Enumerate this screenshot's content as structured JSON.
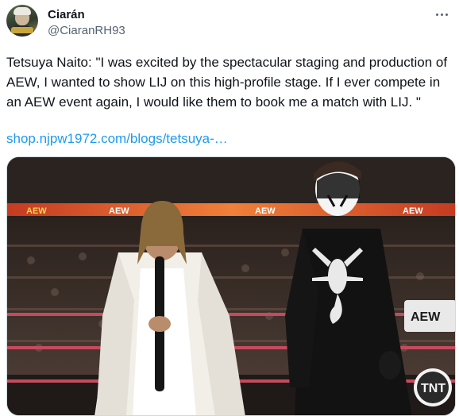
{
  "author": {
    "display_name": "Ciarán",
    "handle": "@CiaranRH93",
    "avatar_icon": "avatar"
  },
  "more_icon": "more-horizontal-icon",
  "tweet": {
    "text": "Tetsuya Naito: \"I was excited by the spectacular staging and production of AEW, I wanted to show LIJ on this high-profile stage. If I ever compete in an AEW event again, I would like them to book me a match with LIJ. \"",
    "link": "shop.njpw1972.com/blogs/tetsuya-…"
  },
  "media": {
    "description": "arena-photo",
    "banner_texts": [
      "AEW",
      "AEW",
      "AEW",
      "AEW"
    ],
    "turnbuckle_text": "AEW",
    "tnt_logo": "TNT",
    "colors": {
      "arena_dark": "#1f1a18",
      "led_orange": "#e8542a",
      "ring_rope": "#c64a5e",
      "white_coat": "#f2efe8",
      "black_shirt": "#121212"
    }
  },
  "colors": {
    "link": "#1d9bf0",
    "secondary_text": "#536471",
    "primary_text": "#0f1419"
  }
}
